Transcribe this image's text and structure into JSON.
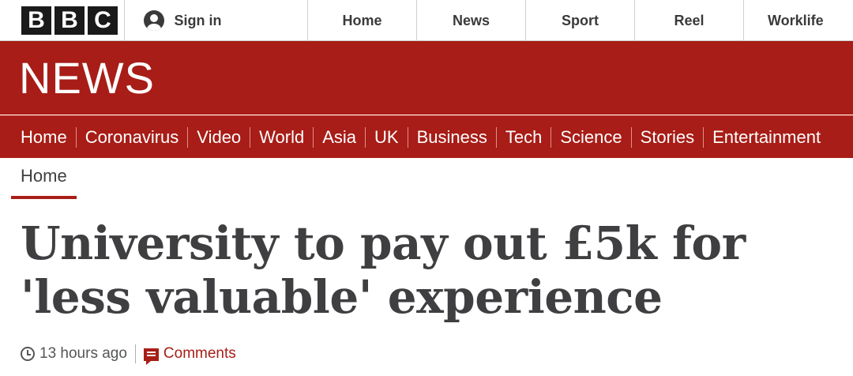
{
  "header": {
    "logo_letters": [
      "B",
      "B",
      "C"
    ],
    "sign_in_label": "Sign in",
    "nav": [
      "Home",
      "News",
      "Sport",
      "Reel",
      "Worklife"
    ]
  },
  "banner": {
    "title": "NEWS"
  },
  "section_nav": [
    "Home",
    "Coronavirus",
    "Video",
    "World",
    "Asia",
    "UK",
    "Business",
    "Tech",
    "Science",
    "Stories",
    "Entertainment"
  ],
  "breadcrumb": {
    "label": "Home"
  },
  "article": {
    "headline": "University to pay out £5k for 'less valuable' experience",
    "timestamp": "13 hours ago",
    "comments_label": "Comments"
  },
  "colors": {
    "brand_red": "#a81d17",
    "text": "#3f3f42"
  },
  "icons": {
    "account": "user-avatar-icon",
    "time": "clock-icon",
    "comments": "comment-bubble-icon"
  }
}
